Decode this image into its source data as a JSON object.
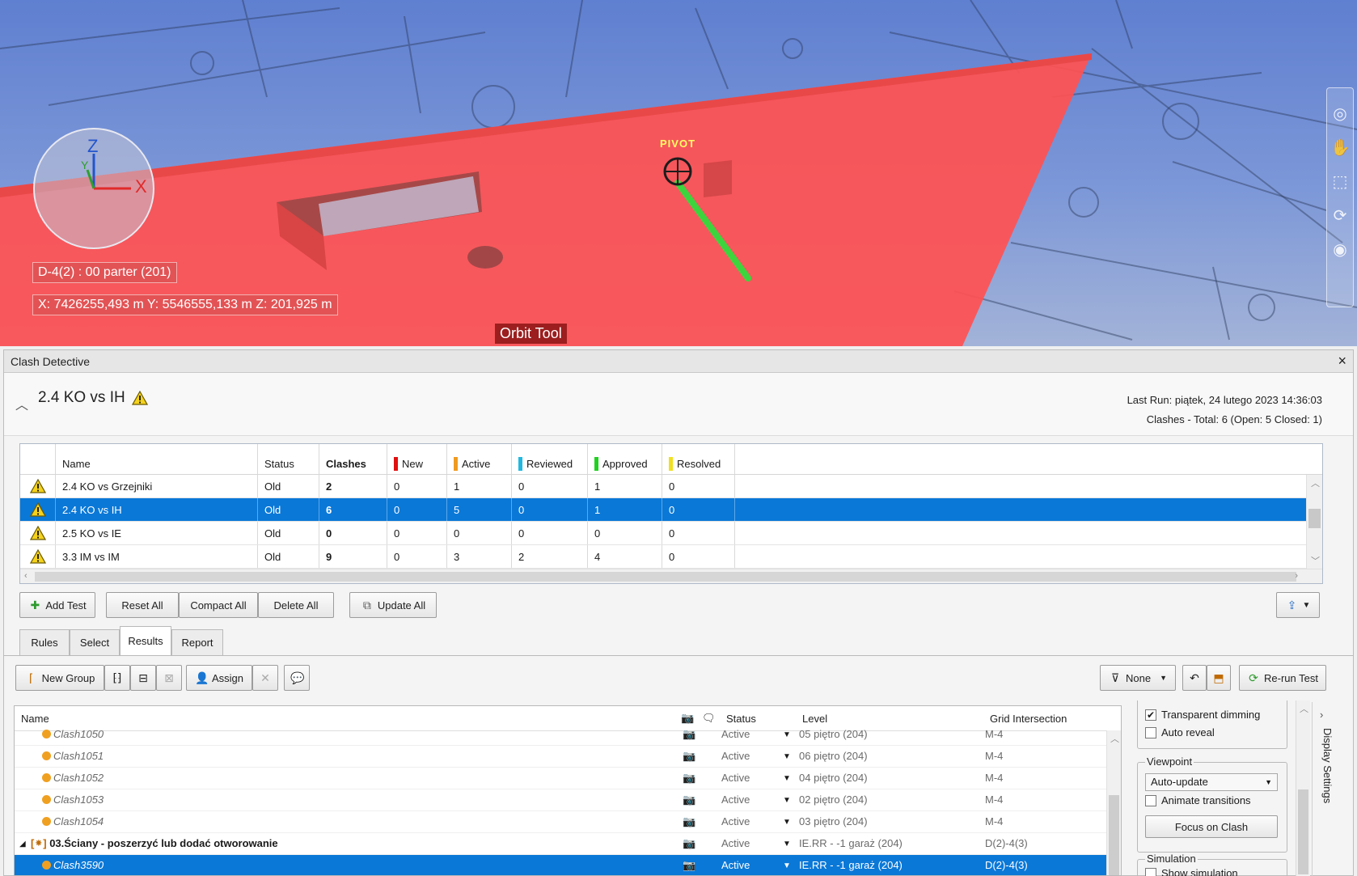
{
  "viewport": {
    "level_label": "D-4(2) : 00 parter (201)",
    "coords_label": "X: 7426255,493 m  Y: 5546555,133 m  Z: 201,925 m",
    "tool_label": "Orbit Tool",
    "pivot_label": "PIVOT",
    "axis_z": "Z",
    "axis_x": "X",
    "axis_y": "Y"
  },
  "panel": {
    "title": "Clash Detective",
    "close": "×"
  },
  "header": {
    "test_name": "2.4 KO vs IH",
    "last_run_label": "Last Run:",
    "last_run_value": "piątek, 24 lutego 2023 14:36:03",
    "summary": "Clashes - Total: 6 (Open: 5 Closed: 1)"
  },
  "tests_table": {
    "columns": [
      "Name",
      "Status",
      "Clashes",
      "New",
      "Active",
      "Reviewed",
      "Approved",
      "Resolved"
    ],
    "status_colors": {
      "new": "#e01010",
      "active": "#f09a20",
      "reviewed": "#20b8e0",
      "approved": "#20d020",
      "resolved": "#f0e020"
    },
    "rows": [
      {
        "name": "2.4 KO vs Grzejniki",
        "status": "Old",
        "clashes": "2",
        "new": "0",
        "active": "1",
        "reviewed": "0",
        "approved": "1",
        "resolved": "0"
      },
      {
        "name": "2.4 KO vs IH",
        "status": "Old",
        "clashes": "6",
        "new": "0",
        "active": "5",
        "reviewed": "0",
        "approved": "1",
        "resolved": "0"
      },
      {
        "name": "2.5 KO vs IE",
        "status": "Old",
        "clashes": "0",
        "new": "0",
        "active": "0",
        "reviewed": "0",
        "approved": "0",
        "resolved": "0"
      },
      {
        "name": "3.3 IM vs IM",
        "status": "Old",
        "clashes": "9",
        "new": "0",
        "active": "3",
        "reviewed": "2",
        "approved": "4",
        "resolved": "0"
      }
    ]
  },
  "test_buttons": {
    "add_test": "Add Test",
    "reset_all": "Reset All",
    "compact_all": "Compact All",
    "delete_all": "Delete All",
    "update_all": "Update All"
  },
  "tabs": [
    "Rules",
    "Select",
    "Results",
    "Report"
  ],
  "results_toolbar": {
    "new_group": "New Group",
    "assign": "Assign",
    "filter_value": "None",
    "rerun": "Re-run Test"
  },
  "results_table": {
    "columns": {
      "name": "Name",
      "status": "Status",
      "level": "Level",
      "grid": "Grid Intersection"
    },
    "rows": [
      {
        "name": "Clash1050",
        "status": "Active",
        "level": "05 piętro (204)",
        "grid": "M-4"
      },
      {
        "name": "Clash1051",
        "status": "Active",
        "level": "06 piętro (204)",
        "grid": "M-4"
      },
      {
        "name": "Clash1052",
        "status": "Active",
        "level": "04 piętro (204)",
        "grid": "M-4"
      },
      {
        "name": "Clash1053",
        "status": "Active",
        "level": "02 piętro (204)",
        "grid": "M-4"
      },
      {
        "name": "Clash1054",
        "status": "Active",
        "level": "03 piętro (204)",
        "grid": "M-4"
      },
      {
        "name": "03.Ściany - poszerzyć lub dodać otworowanie",
        "status": "Active",
        "level": "IE.RR - -1 garaż (204)",
        "grid": "D(2)-4(3)"
      },
      {
        "name": "Clash3590",
        "status": "Active",
        "level": "IE.RR - -1 garaż (204)",
        "grid": "D(2)-4(3)"
      }
    ]
  },
  "display_settings": {
    "side_label": "Display Settings",
    "transparent_dimming": "Transparent dimming",
    "auto_reveal": "Auto reveal",
    "viewpoint_title": "Viewpoint",
    "viewpoint_value": "Auto-update",
    "animate_transitions": "Animate transitions",
    "focus_on_clash": "Focus on Clash",
    "simulation_title": "Simulation",
    "show_simulation": "Show simulation"
  }
}
